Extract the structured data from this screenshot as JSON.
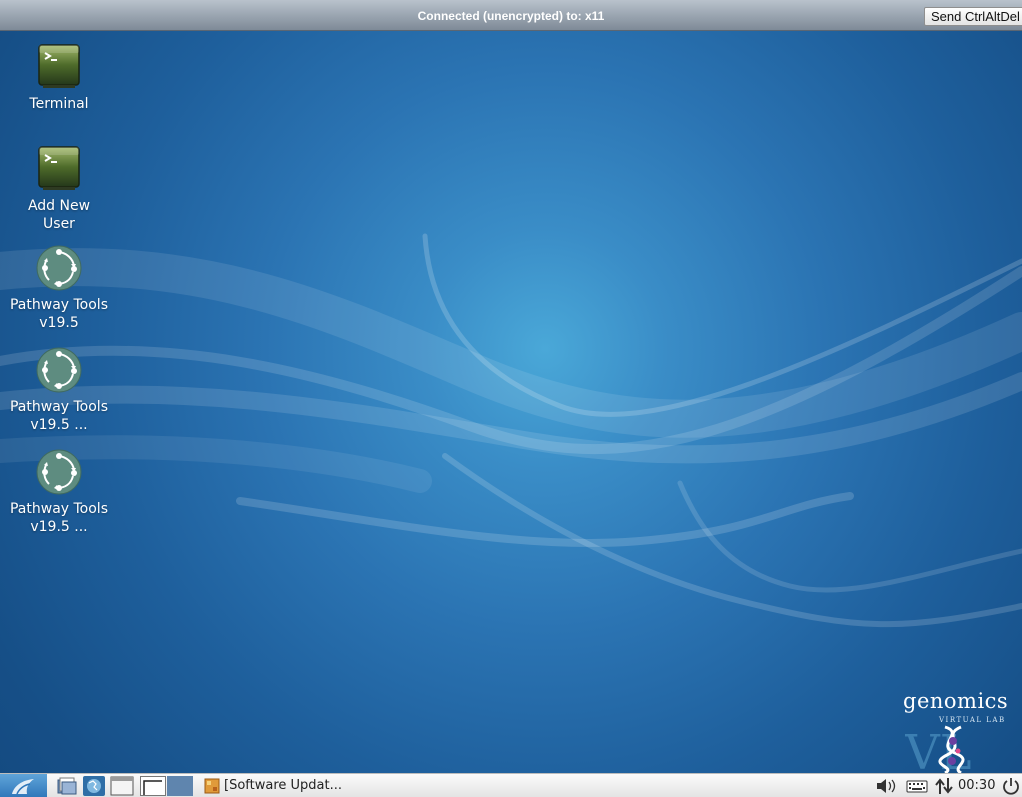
{
  "vnc": {
    "status": "Connected (unencrypted) to: x11",
    "ctrl_alt_del_label": "Send CtrlAltDel"
  },
  "desktop": {
    "icons": [
      {
        "label": "Terminal",
        "icon": "terminal-icon"
      },
      {
        "label": "Add New User",
        "icon": "terminal-icon"
      },
      {
        "label": "Pathway Tools v19.5",
        "icon": "pathway-tools-icon"
      },
      {
        "label": "Pathway Tools v19.5 ...",
        "icon": "pathway-tools-icon"
      },
      {
        "label": "Pathway Tools v19.5 ...",
        "icon": "pathway-tools-icon"
      }
    ],
    "logo_word": "genomics",
    "logo_sub": "VIRTUAL LAB"
  },
  "taskbar": {
    "task_label": "[Software Updat...",
    "clock": "00:30"
  },
  "colors": {
    "desktop_center": "#4aa8d8",
    "desktop_edge": "#12457a",
    "taskbar_bg": "#eeeeee",
    "menu_button": "#2f76b9"
  }
}
